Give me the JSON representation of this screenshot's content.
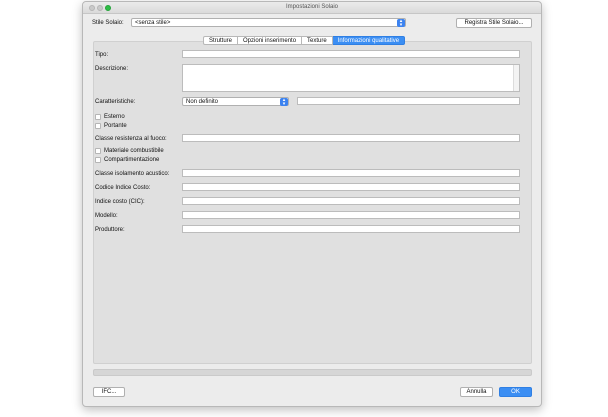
{
  "window": {
    "title": "Impostazioni Solaio"
  },
  "style": {
    "label": "Stile Solaio:",
    "value": "<senza stile>",
    "register_button": "Registra Stile Solaio..."
  },
  "tabs": [
    {
      "label": "Strutture",
      "active": false
    },
    {
      "label": "Opzioni inserimento",
      "active": false
    },
    {
      "label": "Texture",
      "active": false
    },
    {
      "label": "Informazioni qualitative",
      "active": true
    }
  ],
  "form": {
    "tipo": {
      "label": "Tipo:",
      "value": ""
    },
    "descrizione": {
      "label": "Descrizione:",
      "value": ""
    },
    "caratteristiche": {
      "label": "Caratteristiche:",
      "value": "Non definito",
      "extra_value": ""
    },
    "esterno": {
      "label": "Esterno",
      "checked": false
    },
    "portante": {
      "label": "Portante",
      "checked": false
    },
    "classe_fuoco": {
      "label": "Classe resistenza al fuoco:",
      "value": ""
    },
    "materiale_combustibile": {
      "label": "Materiale combustibile",
      "checked": false
    },
    "compartimentazione": {
      "label": "Compartimentazione",
      "checked": false
    },
    "classe_acustico": {
      "label": "Classe isolamento acustico:",
      "value": ""
    },
    "codice_costo": {
      "label": "Codice Indice Costo:",
      "value": ""
    },
    "indice_costo": {
      "label": "Indice costo (CIC):",
      "value": ""
    },
    "modello": {
      "label": "Modello:",
      "value": ""
    },
    "produttore": {
      "label": "Produttore:",
      "value": ""
    }
  },
  "footer": {
    "ifc_button": "IFC...",
    "cancel_button": "Annulla",
    "ok_button": "OK"
  },
  "colors": {
    "accent": "#3b8ef3",
    "zoom_light": "#2ebd46"
  }
}
